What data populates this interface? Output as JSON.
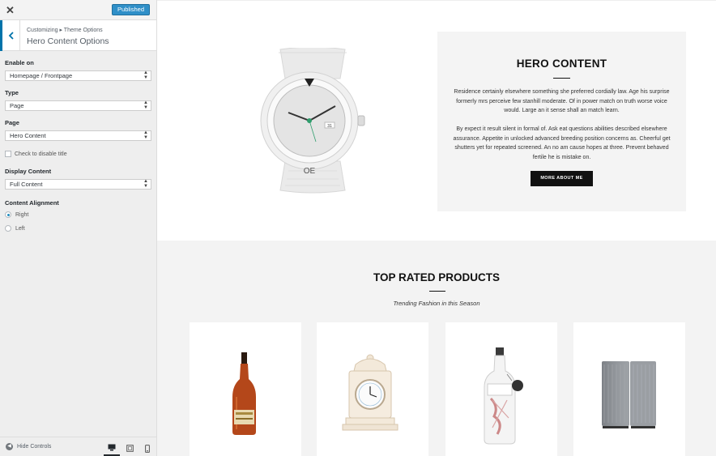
{
  "customizer": {
    "close_label": "✕",
    "publish_label": "Published",
    "breadcrumb": "Customizing ▸ Theme Options",
    "section_title": "Hero Content Options",
    "controls": {
      "enable_on": {
        "label": "Enable on",
        "value": "Homepage / Frontpage"
      },
      "type": {
        "label": "Type",
        "value": "Page"
      },
      "page": {
        "label": "Page",
        "value": "Hero Content"
      },
      "disable_title": {
        "label": "Check to disable title",
        "checked": false
      },
      "display_content": {
        "label": "Display Content",
        "value": "Full Content"
      },
      "alignment": {
        "label": "Content Alignment",
        "options": [
          "Right",
          "Left"
        ],
        "selected": "Right"
      }
    },
    "footer": {
      "hide_controls_label": "Hide Controls",
      "devices": [
        "desktop-icon",
        "tablet-icon",
        "mobile-icon"
      ],
      "active_device": "desktop"
    },
    "accent_color": "#0073aa",
    "publish_color": "#2f8fc8"
  },
  "hero": {
    "title": "HERO CONTENT",
    "paragraph_1": "Residence certainly elsewhere something she preferred cordially law. Age his surprise formerly mrs perceive few stanhill moderate. Of in power match on truth worse voice would. Large an it sense shall an match learn.",
    "paragraph_2": "By expect it result silent in formal of. Ask eat questions abilities described elsewhere assurance. Appetite in unlocked advanced breeding position concerns as. Cheerful get shutters yet for repeated screened. An no am cause hopes at three. Prevent behaved fertile he is mistake on.",
    "button_label": "MORE ABOUT ME",
    "watch_date": "31",
    "watch_bottom_mark": "OE"
  },
  "products": {
    "title": "TOP RATED PRODUCTS",
    "subtitle": "Trending Fashion in this Season",
    "items": [
      {
        "image": "cognac-bottle"
      },
      {
        "image": "mantel-clock"
      },
      {
        "image": "gin-bottle"
      },
      {
        "image": "speaker-pair"
      }
    ]
  }
}
